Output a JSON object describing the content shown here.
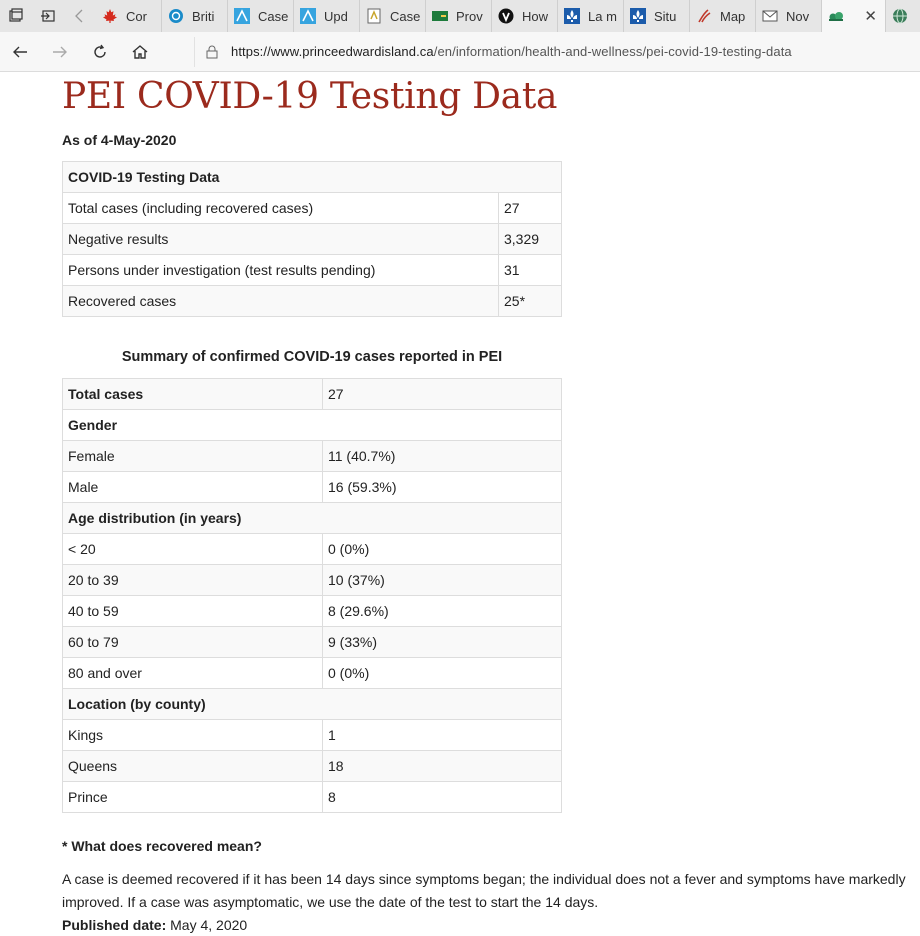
{
  "browser": {
    "tabs": [
      {
        "label": "Cor",
        "icon": "canada-leaf-icon"
      },
      {
        "label": "Briti",
        "icon": "bc-government-icon"
      },
      {
        "label": "Case",
        "icon": "alberta-icon"
      },
      {
        "label": "Upd",
        "icon": "alberta-icon"
      },
      {
        "label": "Case",
        "icon": "document-icon"
      },
      {
        "label": "Prov",
        "icon": "saskatchewan-icon"
      },
      {
        "label": "How",
        "icon": "vpn-shield-icon"
      },
      {
        "label": "La m",
        "icon": "quebec-fleur-icon"
      },
      {
        "label": "Situ",
        "icon": "quebec-fleur-icon"
      },
      {
        "label": "Map",
        "icon": "map-pin-icon"
      },
      {
        "label": "Nov",
        "icon": "envelope-icon"
      }
    ],
    "active_tab_icon": "pei-government-icon",
    "url_host": "https://www.princeedwardisland.ca",
    "url_path": "/en/information/health-and-wellness/pei-covid-19-testing-data"
  },
  "page": {
    "title": "PEI COVID-19 Testing Data",
    "as_of": "As of 4-May-2020",
    "testing_table": {
      "header": "COVID-19 Testing Data",
      "rows": [
        {
          "label": "Total cases (including recovered cases)",
          "value": "27"
        },
        {
          "label": "Negative results",
          "value": "3,329"
        },
        {
          "label": "Persons under investigation (test results pending)",
          "value": "31"
        },
        {
          "label": "Recovered cases",
          "value": "25*"
        }
      ]
    },
    "summary_caption": "Summary of confirmed COVID-19 cases reported in PEI",
    "summary": {
      "total_label": "Total cases",
      "total_value": "27",
      "gender_header": "Gender",
      "gender": [
        {
          "label": "Female",
          "value": "11 (40.7%)"
        },
        {
          "label": "Male",
          "value": "16 (59.3%)"
        }
      ],
      "age_header": "Age distribution (in years)",
      "age": [
        {
          "label": "< 20",
          "value": "0 (0%)"
        },
        {
          "label": "20 to 39",
          "value": "10 (37%)"
        },
        {
          "label": "40 to 59",
          "value": "8 (29.6%)"
        },
        {
          "label": "60 to 79",
          "value": "9 (33%)"
        },
        {
          "label": "80 and over",
          "value": "0 (0%)"
        }
      ],
      "location_header": "Location (by county)",
      "location": [
        {
          "label": "Kings",
          "value": "1"
        },
        {
          "label": "Queens",
          "value": "18"
        },
        {
          "label": "Prince",
          "value": "8"
        }
      ]
    },
    "recovered_question": "* What does recovered mean?",
    "recovered_answer": "A case is deemed recovered if it has been 14 days since symptoms began; the individual does not a fever and symptoms have markedly improved. If a case was asymptomatic, we use the date of the test to start the 14 days.",
    "published_label": "Published date:",
    "published_value": "May 4, 2020"
  }
}
